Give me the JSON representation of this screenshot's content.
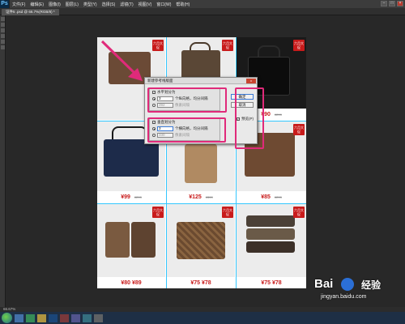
{
  "app": {
    "logo": "Ps",
    "menus": [
      "文件(F)",
      "编辑(E)",
      "图像(I)",
      "图层(L)",
      "类型(Y)",
      "选择(S)",
      "滤镜(T)",
      "视图(V)",
      "窗口(W)",
      "帮助(H)"
    ],
    "window_controls": [
      "–",
      "□",
      "×"
    ]
  },
  "document_tab": "证件5 .psd @ 66.7%(RGB/8) *",
  "status_zoom": "66.67%",
  "dialog": {
    "title": "新建参考线版面",
    "close_label": "x",
    "horizontal": {
      "checkbox_label": "水平划分为",
      "checked": true,
      "count_value": "3",
      "count_suffix": "个纵向格，均分间隔",
      "pixel_value": "392",
      "pixel_suffix": "像素间隔"
    },
    "vertical": {
      "checkbox_label": "垂直划分为",
      "checked": true,
      "count_value": "3",
      "count_suffix": "个横向格，均分间隔",
      "pixel_value": "330",
      "pixel_suffix": "像素间隔"
    },
    "ok_label": "确定",
    "cancel_label": "取消",
    "preview_label": "预览(P)"
  },
  "products": [
    {
      "badge": "六月大促",
      "price": "",
      "old_price": "",
      "style": "light"
    },
    {
      "badge": "六月大促",
      "price": "",
      "old_price": "",
      "style": "light"
    },
    {
      "badge": "六月大促",
      "price": "¥90",
      "old_price": "¥299",
      "style": "dark"
    },
    {
      "badge": "",
      "price": "¥99",
      "old_price": "¥299",
      "style": "light"
    },
    {
      "badge": "",
      "price": "¥125",
      "old_price": "¥399",
      "style": "light"
    },
    {
      "badge": "六月大促",
      "price": "¥85",
      "old_price": "¥299",
      "style": "light"
    },
    {
      "badge": "六月大促",
      "price": "¥80 ¥89",
      "old_price": "",
      "style": "light"
    },
    {
      "badge": "六月大促",
      "price": "¥75 ¥78",
      "old_price": "",
      "style": "light"
    },
    {
      "badge": "六月大促",
      "price": "¥75 ¥78",
      "old_price": "",
      "style": "light"
    }
  ],
  "watermark": {
    "brand": "Bai",
    "brand_cn": "经验",
    "url": "jingyan.baidu.com"
  },
  "colors": {
    "highlight": "#e02a7a",
    "price_red": "#c81b1b",
    "guide": "#33c7ff"
  }
}
